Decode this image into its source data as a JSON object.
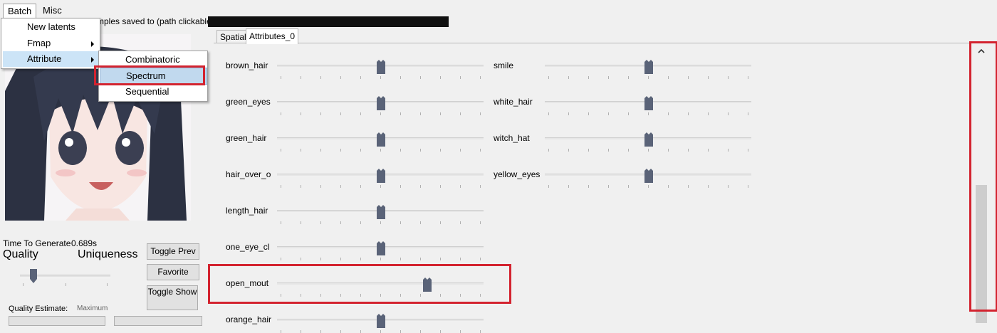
{
  "menubar": {
    "batch": "Batch",
    "misc": "Misc"
  },
  "batch_menu": {
    "items": [
      {
        "label": "New latents",
        "submenu": false
      },
      {
        "label": "Fmap",
        "submenu": true
      },
      {
        "label": "Attribute",
        "submenu": true
      }
    ]
  },
  "attribute_submenu": {
    "items": [
      "Combinatoric",
      "Spectrum",
      "Sequential"
    ],
    "selected": "Spectrum"
  },
  "header": {
    "path_label": "mples saved to (path clickable):"
  },
  "generation": {
    "time_label": "Time To Generate",
    "time_value": "0.689s",
    "quality_label": "Quality",
    "uniqueness_label": "Uniqueness",
    "quality_estimate_label": "Quality Estimate:",
    "quality_estimate_value": "Maximum"
  },
  "buttons": {
    "toggle_prev": "Toggle Prev",
    "favorite": "Favorite",
    "toggle_show": "Toggle Show"
  },
  "tabs": [
    {
      "label": "Spatial",
      "active": false
    },
    {
      "label": "Attributes_0",
      "active": true
    }
  ],
  "attributes_left": [
    {
      "label": "brown_hair",
      "value": 0.5
    },
    {
      "label": "green_eyes",
      "value": 0.5
    },
    {
      "label": "green_hair",
      "value": 0.5
    },
    {
      "label": "hair_over_o",
      "value": 0.5
    },
    {
      "label": "length_hair",
      "value": 0.5
    },
    {
      "label": "one_eye_cl",
      "value": 0.5
    },
    {
      "label": "open_mout",
      "value": 0.74
    },
    {
      "label": "orange_hair",
      "value": 0.5
    }
  ],
  "attributes_right": [
    {
      "label": "smile",
      "value": 0.5
    },
    {
      "label": "white_hair",
      "value": 0.5
    },
    {
      "label": "witch_hat",
      "value": 0.5
    },
    {
      "label": "yellow_eyes",
      "value": 0.5
    }
  ],
  "colors": {
    "highlight_red": "#d3232f",
    "thumb": "#5a6378",
    "menu_highlight": "#cce4f7"
  },
  "icons": {
    "scroll_up": "chevron-up-icon",
    "submenu_arrow": "caret-right-icon"
  }
}
